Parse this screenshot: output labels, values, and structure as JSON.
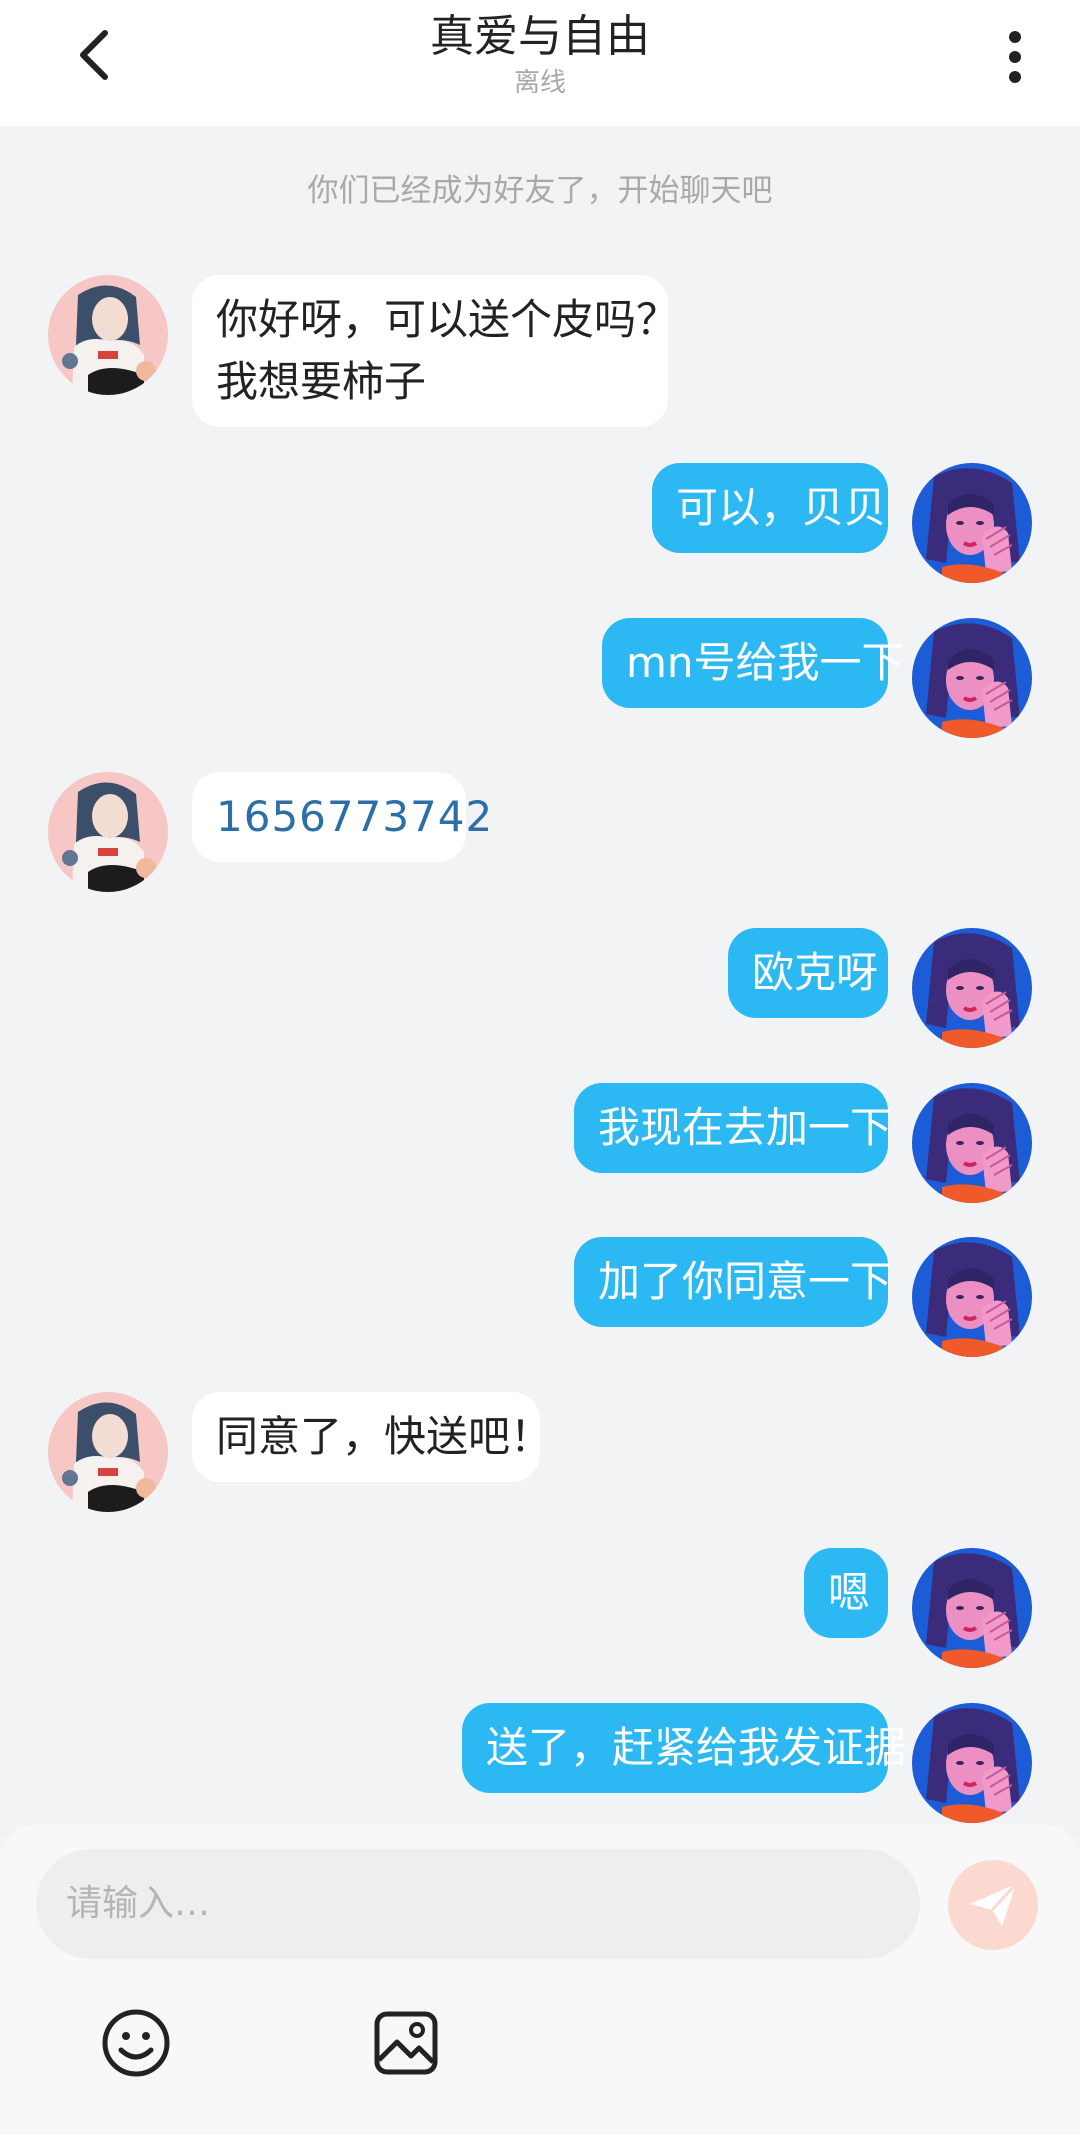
{
  "header": {
    "title": "真爱与自由",
    "status": "离线"
  },
  "system_message": "你们已经成为好友了，开始聊天吧",
  "messages": [
    {
      "side": "left",
      "lines": [
        "你好呀，可以送个皮吗？",
        "我想要柿子"
      ]
    },
    {
      "side": "right",
      "lines": [
        "可以，贝贝"
      ]
    },
    {
      "side": "right",
      "lines": [
        "mn号给我一下"
      ]
    },
    {
      "side": "left",
      "lines": [
        "1656773742"
      ]
    },
    {
      "side": "right",
      "lines": [
        "欧克呀"
      ]
    },
    {
      "side": "right",
      "lines": [
        "我现在去加一下"
      ]
    },
    {
      "side": "right",
      "lines": [
        "加了你同意一下"
      ]
    },
    {
      "side": "left",
      "lines": [
        "同意了，快送吧！"
      ]
    },
    {
      "side": "right",
      "lines": [
        "嗯"
      ]
    },
    {
      "side": "right",
      "lines": [
        "送了，赶紧给我发证据"
      ]
    }
  ],
  "input": {
    "placeholder": "请输入…"
  },
  "icons": {
    "back": "chevron-left-icon",
    "more": "more-vertical-icon",
    "send": "paper-plane-icon",
    "emoji": "smiley-icon",
    "image": "image-icon"
  },
  "colors": {
    "outgoing_bubble": "#2cb8f3",
    "incoming_bubble": "#ffffff",
    "chat_background": "#f2f3f5",
    "send_button": "#fbd9d1"
  }
}
